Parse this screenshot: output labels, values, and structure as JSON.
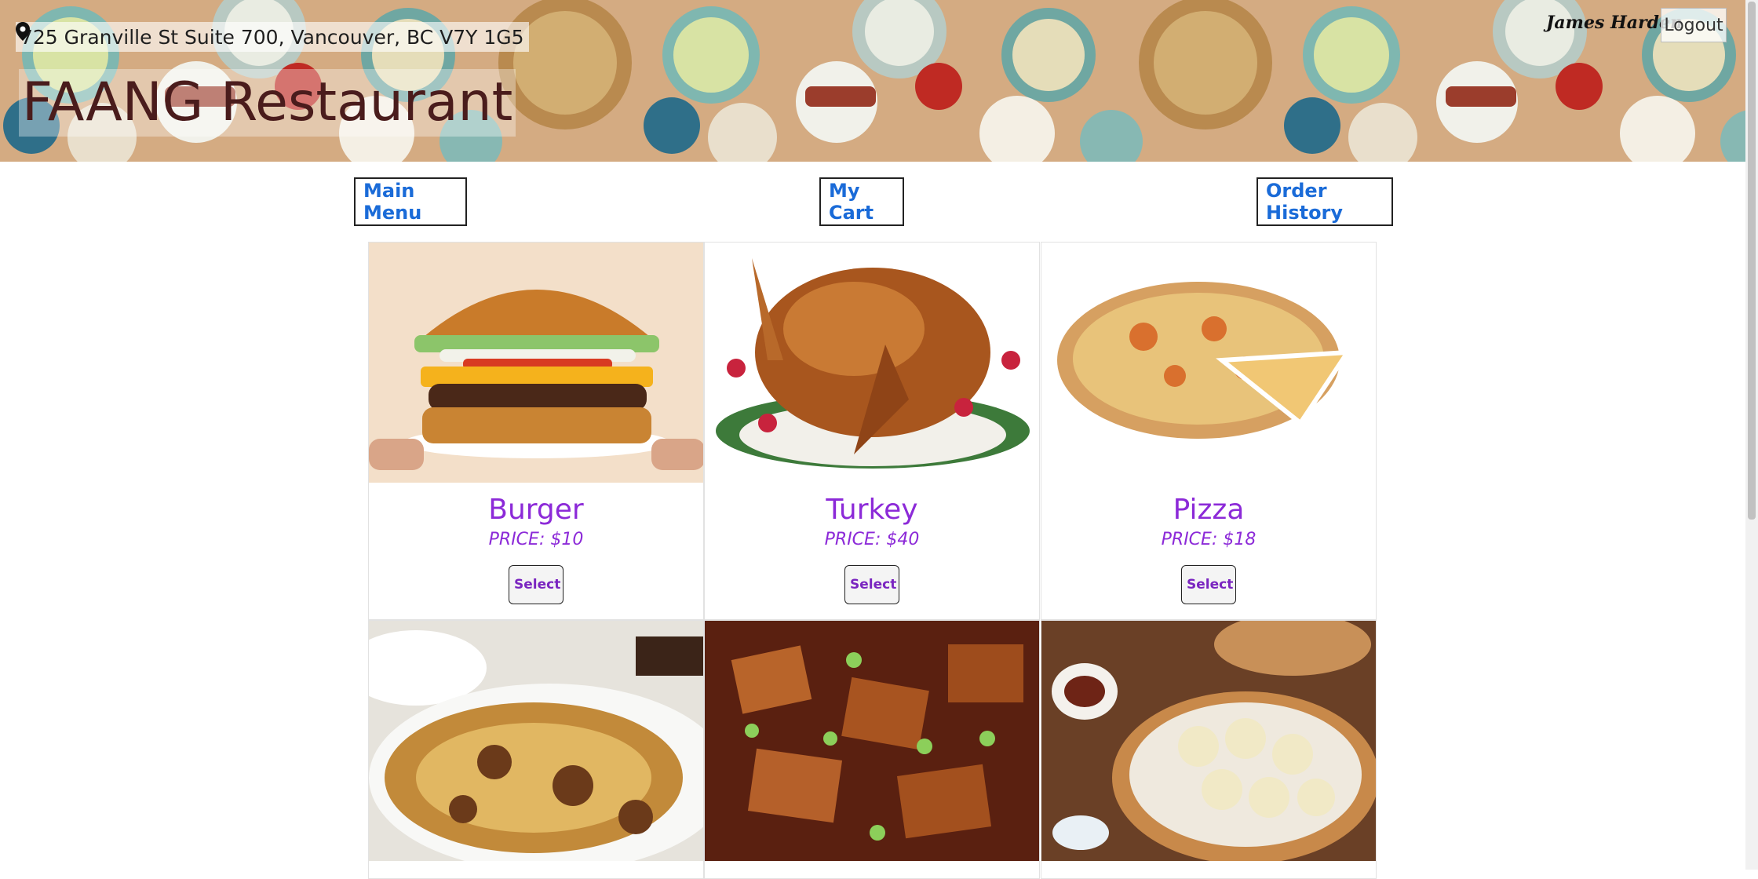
{
  "header": {
    "address": "725 Granville St Suite 700, Vancouver, BC V7Y 1G5",
    "restaurant_name": "FAANG Restaurant",
    "user_name": "James Harden",
    "logout_label": "Logout",
    "location_icon": "map-pin-icon"
  },
  "nav": {
    "main_menu": "Main Menu",
    "my_cart": "My Cart",
    "order_history": "Order History"
  },
  "menu_items": [
    {
      "name": "Burger",
      "price": "PRICE: $10",
      "select_label": "Select"
    },
    {
      "name": "Turkey",
      "price": "PRICE: $40",
      "select_label": "Select"
    },
    {
      "name": "Pizza",
      "price": "PRICE: $18",
      "select_label": "Select"
    },
    {
      "name": "",
      "price": "",
      "select_label": ""
    },
    {
      "name": "",
      "price": "",
      "select_label": ""
    },
    {
      "name": "",
      "price": "",
      "select_label": ""
    }
  ],
  "colors": {
    "accent": "#8c2ad8",
    "nav_link": "#1a6bd8",
    "brand_text": "#4a1c1c"
  }
}
